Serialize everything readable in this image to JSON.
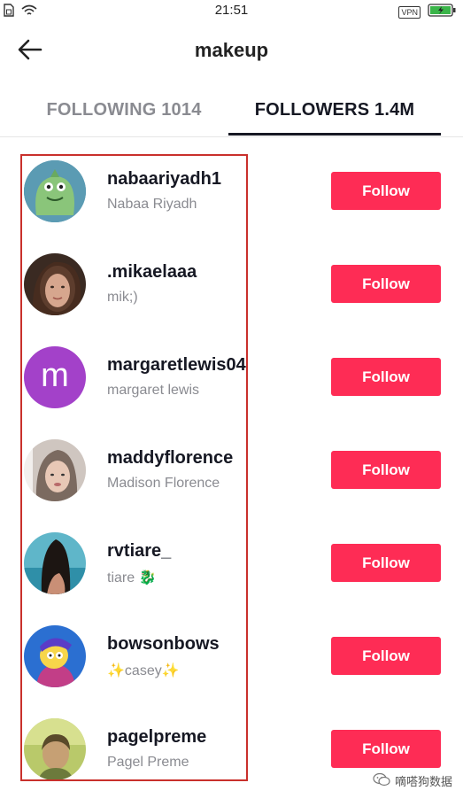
{
  "status_bar": {
    "time": "21:51",
    "vpn_label": "VPN",
    "icons": [
      "sim-icon",
      "wifi-icon",
      "battery-charging-icon"
    ]
  },
  "header": {
    "title": "makeup",
    "back_icon": "arrow-left-icon"
  },
  "tabs": [
    {
      "label": "FOLLOWING 1014",
      "active": false
    },
    {
      "label": "FOLLOWERS 1.4M",
      "active": true
    }
  ],
  "follow_button_label": "Follow",
  "users": [
    {
      "username": "nabaariyadh1",
      "display_name": "Nabaa Riyadh",
      "avatar": "green-cartoon-avatar"
    },
    {
      "username": ".mikaelaaa",
      "display_name": "mik;)",
      "avatar": "photo-avatar"
    },
    {
      "username": "margaretlewis04",
      "display_name": "margaret lewis",
      "avatar_letter": "m"
    },
    {
      "username": "maddyflorence",
      "display_name": "Madison Florence",
      "avatar": "photo-avatar"
    },
    {
      "username": "rvtiare_",
      "display_name": "tiare 🐉",
      "avatar": "photo-avatar"
    },
    {
      "username": "bowsonbows",
      "display_name": "✨casey✨",
      "avatar": "cartoon-avatar"
    },
    {
      "username": "pagelpreme",
      "display_name": "Pagel Preme",
      "avatar": "photo-avatar"
    }
  ],
  "watermark": {
    "text": "嘀嗒狗数据",
    "icon": "wechat-icon"
  },
  "colors": {
    "follow_button": "#fe2c55",
    "active_tab": "#161823",
    "inactive_tab": "#8a8b91",
    "highlight_box": "#c9302c",
    "avatar_letter_bg": "#a341c9"
  }
}
